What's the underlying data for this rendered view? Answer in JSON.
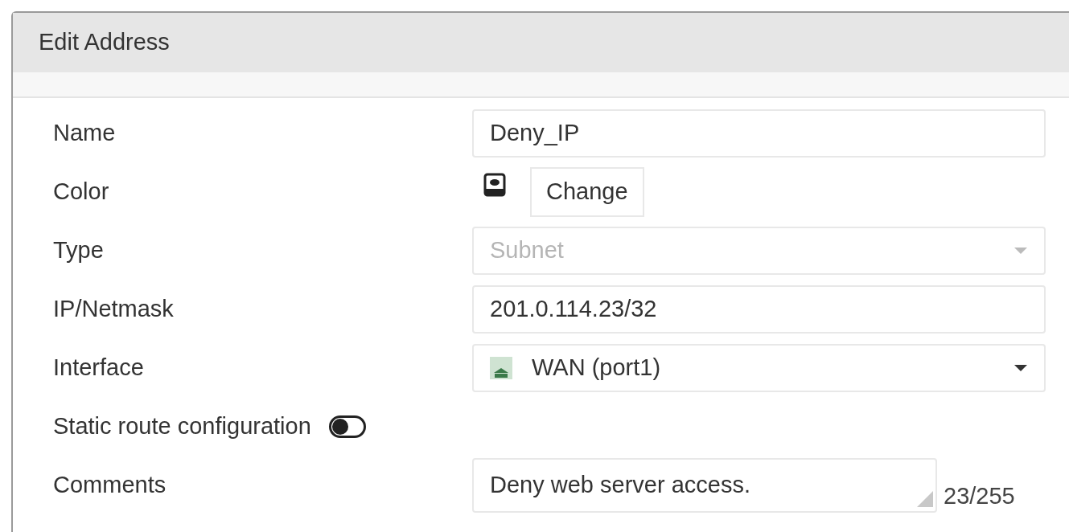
{
  "dialog": {
    "title": "Edit Address"
  },
  "fields": [
    {
      "kind": "text",
      "label": "Name",
      "value": "Deny_IP"
    },
    {
      "kind": "color",
      "label": "Color",
      "button": "Change"
    },
    {
      "kind": "select",
      "label": "Type",
      "value": "Subnet",
      "disabled": true
    },
    {
      "kind": "text",
      "label": "IP/Netmask",
      "value": "201.0.114.23/32"
    },
    {
      "kind": "select",
      "label": "Interface",
      "value": "WAN (port1)",
      "disabled": false,
      "icon": true
    },
    {
      "kind": "toggle",
      "label": "Static route configuration",
      "on": false
    },
    {
      "kind": "textarea",
      "label": "Comments",
      "value": "Deny web server access.",
      "counter": "23/255"
    }
  ]
}
